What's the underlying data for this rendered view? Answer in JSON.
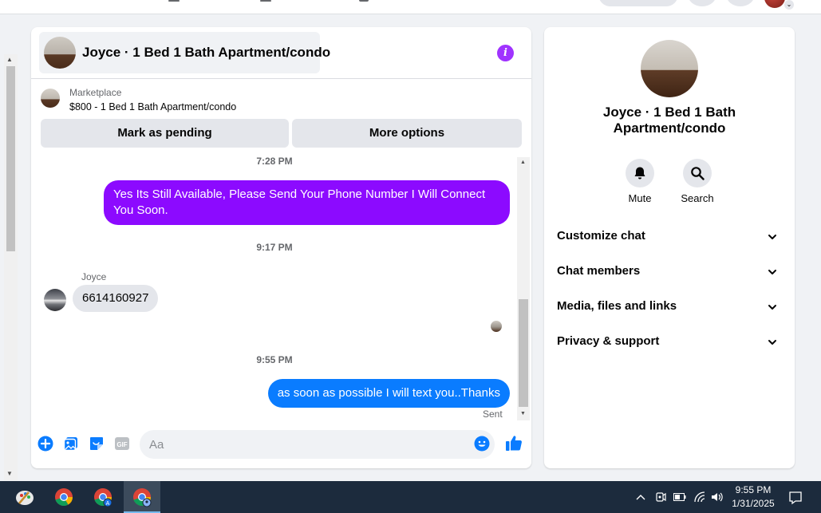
{
  "conversation": {
    "title": "Joyce · 1 Bed 1 Bath Apartment/condo",
    "info_icon": "info-icon"
  },
  "marketplace": {
    "label": "Marketplace",
    "listing": "$800 - 1 Bed 1 Bath Apartment/condo",
    "mark_pending_label": "Mark as pending",
    "more_options_label": "More options"
  },
  "messages": [
    {
      "type": "timestamp",
      "text": "7:28 PM"
    },
    {
      "type": "outgoing",
      "text": "Yes Its Still Available, Please Send Your Phone Number I Will Connect You Soon.",
      "color": "#8c0aff"
    },
    {
      "type": "timestamp",
      "text": "9:17 PM"
    },
    {
      "type": "incoming",
      "sender": "Joyce",
      "text": "6614160927"
    },
    {
      "type": "timestamp",
      "text": "9:55 PM"
    },
    {
      "type": "outgoing",
      "text": "as soon as possible I will text you..Thanks",
      "color": "#0a7cff",
      "status": "Sent"
    }
  ],
  "composer": {
    "placeholder": "Aa",
    "icons": [
      "plus-circle-icon",
      "photo-icon",
      "sticker-icon",
      "gif-icon",
      "emoji-icon",
      "thumbs-up-icon"
    ]
  },
  "sidebar": {
    "title": "Joyce · 1 Bed 1 Bath Apartment/condo",
    "actions": [
      {
        "label": "Mute",
        "icon": "bell-icon"
      },
      {
        "label": "Search",
        "icon": "search-icon"
      }
    ],
    "sections": [
      {
        "label": "Customize chat"
      },
      {
        "label": "Chat members"
      },
      {
        "label": "Media, files and links"
      },
      {
        "label": "Privacy & support"
      }
    ]
  },
  "taskbar": {
    "time": "9:55 PM",
    "date": "1/31/2025",
    "apps": [
      "paint-app-icon",
      "chrome-icon",
      "chrome-profile-a-icon",
      "chrome-profile-icon"
    ]
  },
  "colors": {
    "accent_purple": "#8c0aff",
    "messenger_blue": "#0a7cff",
    "info_purple": "#a033ff"
  }
}
